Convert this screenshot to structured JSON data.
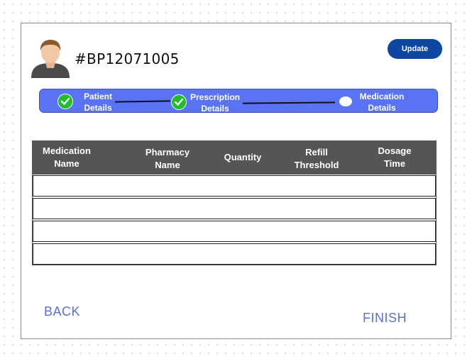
{
  "patient": {
    "id": "#BP12071005",
    "avatar_icon": "user-avatar-icon"
  },
  "header": {
    "update_label": "Update"
  },
  "stepper": {
    "steps": [
      {
        "line1": "Patient",
        "line2": "Details",
        "state": "complete"
      },
      {
        "line1": "Prescription",
        "line2": "Details",
        "state": "complete"
      },
      {
        "line1": "Medication",
        "line2": "Details",
        "state": "current"
      }
    ],
    "accent": "#5a73f5",
    "complete_color": "#1fbf2c"
  },
  "table": {
    "columns": [
      {
        "line1": "Medication",
        "line2": "Name"
      },
      {
        "line1": "Pharmacy",
        "line2": "Name"
      },
      {
        "line1": "Quantity",
        "line2": ""
      },
      {
        "line1": "Refill",
        "line2": "Threshold"
      },
      {
        "line1": "Dosage",
        "line2": "Time"
      }
    ],
    "rows": [
      [
        "",
        "",
        "",
        "",
        ""
      ],
      [
        "",
        "",
        "",
        "",
        ""
      ],
      [
        "",
        "",
        "",
        "",
        ""
      ],
      [
        "",
        "",
        "",
        "",
        ""
      ]
    ],
    "header_color": "#555555"
  },
  "footer": {
    "back_label": "BACK",
    "finish_label": "FINISH",
    "link_color": "#5b6fd6"
  }
}
